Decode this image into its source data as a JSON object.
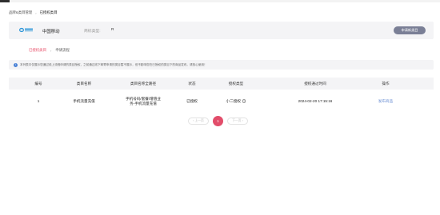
{
  "breadcrumb": {
    "parent": "品牌&类目管理",
    "separator": "›",
    "current": "已授权类目"
  },
  "header": {
    "brand_name": "中国移动",
    "logo_icon": "china-mobile-logo",
    "brand_color": "#1f8fd6",
    "platform_label": "商标类型:",
    "platform_value": "R",
    "apply_button": "申请新类目"
  },
  "tabs": {
    "active": "已授权类目",
    "separator": "›",
    "other": "申请流程"
  },
  "notice": {
    "icon": "info-icon",
    "text": "本列表中仅展示您通过线上流程申请的类目授权，之前通过线下邮寄申请的类目暂不展示，但不影响您在已授权的类目下的商品发布。请放心使用！"
  },
  "table": {
    "columns": [
      "编号",
      "类目名称",
      "类目名称全路径",
      "状态",
      "授权类型",
      "授权通过时间",
      "操作"
    ],
    "rows": [
      {
        "id": "1",
        "name": "手机流量充值",
        "path_line1": "手机号码/套餐/增值业",
        "path_line2": "务-手机流量充值",
        "status": "已授权",
        "auth_type": "小二授权",
        "auth_type_icon": "question-icon",
        "approved_time": "2024-02-20 17:15:16",
        "action": "发布商品"
      }
    ]
  },
  "pagination": {
    "prev": "‹ 上一页",
    "current_page": "1",
    "next": "下一页 ›"
  },
  "colors": {
    "accent": "#e24d6a",
    "link": "#6b8fd3",
    "button": "#7a7f96"
  }
}
